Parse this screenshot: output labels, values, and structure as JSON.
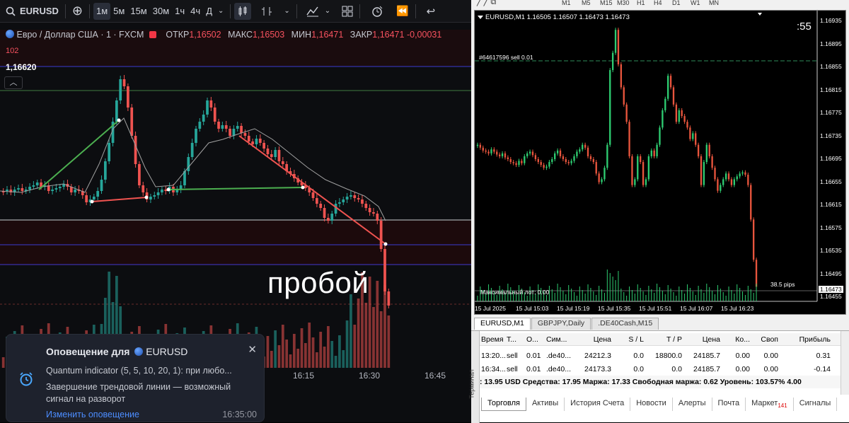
{
  "tv": {
    "symbol": "EURUSD",
    "timeframes": [
      "1м",
      "5м",
      "15м",
      "30м",
      "1ч",
      "4ч",
      "Д"
    ],
    "active_timeframe": "1м",
    "legend": {
      "title": "Евро / Доллар США · 1 · FXCM",
      "open_label": "ОТКР",
      "open": "1,16502",
      "high_label": "МАКС",
      "high": "1,16503",
      "low_label": "МИН",
      "low": "1,16471",
      "close_label": "ЗАКР",
      "close": "1,16471",
      "change": "-0,00031",
      "line2": "102"
    },
    "price_label": "1,16620",
    "annotation": "пробой",
    "time_ticks": [
      "16:15",
      "16:30",
      "16:45"
    ],
    "colors": {
      "bull": "#26a69a",
      "bear": "#ef5350",
      "bg": "#0c0d10"
    },
    "alert": {
      "title": "Оповещение для",
      "symbol": "EURUSD",
      "line1": "Quantum indicator (5, 5, 10, 20, 1): при любо...",
      "line2": "Завершение трендовой линии — возможный сигнал на разворот",
      "link": "Изменить оповещение",
      "time": "16:35:00"
    }
  },
  "mt": {
    "top_periods": [
      "M1",
      "M5",
      "M15",
      "M30",
      "H1",
      "H4",
      "D1",
      "W1",
      "MN"
    ],
    "header": "EURUSD,M1  1.16505 1.16507 1.16473 1.16473",
    "countdown": ":55",
    "order_line": "#64617596 sell 0.01",
    "max_lot": "Максимальный лот: 0.00",
    "pips": "38.5 pips",
    "current_price": "1.16473",
    "y_ticks": [
      "1.16935",
      "1.16895",
      "1.16855",
      "1.16815",
      "1.16775",
      "1.16735",
      "1.16695",
      "1.16655",
      "1.16615",
      "1.16575",
      "1.16535",
      "1.16495",
      "1.16455"
    ],
    "x_ticks": [
      "15 Jul 2025",
      "15 Jul 15:03",
      "15 Jul 15:19",
      "15 Jul 15:35",
      "15 Jul 15:51",
      "15 Jul 16:07",
      "15 Jul 16:23"
    ],
    "window_tabs": [
      "EURUSD,M1",
      "GBPJPY,Daily",
      ".DE40Cash,M15"
    ],
    "terminal_side": "Терминал",
    "columns": [
      "Время",
      "Т...",
      "О...",
      "Сим...",
      "Цена",
      "S / L",
      "T / P",
      "Цена",
      "Ко...",
      "Своп",
      "Прибыль"
    ],
    "rows": [
      [
        "13:20...",
        "sell",
        "0.01",
        ".de40...",
        "24212.3",
        "0.0",
        "18800.0",
        "24185.7",
        "0.00",
        "0.00",
        "0.31"
      ],
      [
        "16:34...",
        "sell",
        "0.01",
        ".de40...",
        "24173.3",
        "0.0",
        "0.0",
        "24185.7",
        "0.00",
        "0.00",
        "-0.14"
      ]
    ],
    "balance": ": 13.95 USD  Средства: 17.95  Маржа: 17.33  Свободная маржа: 0.62  Уровень: 103.57%  4.00",
    "bottom_tabs": [
      "Торговля",
      "Активы",
      "История Счета",
      "Новости",
      "Алерты",
      "Почта",
      "Маркет",
      "Сигналы"
    ],
    "market_badge": "141",
    "chart_data": {
      "type": "candlestick",
      "series": [
        {
          "name": "EURUSD,M1",
          "close": [
            1.1672,
            1.16715,
            1.1671,
            1.16708,
            1.16705,
            1.16712,
            1.16708,
            1.16703,
            1.167,
            1.16705,
            1.16698,
            1.16695,
            1.1669,
            1.16688,
            1.16685,
            1.16692,
            1.16688,
            1.167,
            1.16705,
            1.16708,
            1.16702,
            1.16695,
            1.1669,
            1.16685,
            1.1668,
            1.16682,
            1.1669,
            1.16695,
            1.16705,
            1.1671,
            1.167,
            1.16695,
            1.1669,
            1.16688,
            1.16692,
            1.167,
            1.16708,
            1.16712,
            1.1672,
            1.16715,
            1.167,
            1.16695,
            1.1669,
            1.1667,
            1.16655,
            1.1666,
            1.1668,
            1.1672,
            1.1685,
            1.1688,
            1.1692,
            1.1686,
            1.1682,
            1.1679,
            1.1676,
            1.167,
            1.1665,
            1.1666,
            1.167,
            1.1669,
            1.1665,
            1.1666,
            1.167,
            1.1671,
            1.167,
            1.1672,
            1.1675,
            1.1678,
            1.168,
            1.1684,
            1.1682,
            1.1679,
            1.1676,
            1.1678,
            1.1677,
            1.1676,
            1.1675,
            1.1673,
            1.1674,
            1.1672,
            1.167,
            1.1665,
            1.1669,
            1.1672,
            1.167,
            1.1668,
            1.1666,
            1.1664,
            1.1665,
            1.1666,
            1.1667,
            1.1666,
            1.1665,
            1.1666,
            1.16665,
            1.1667,
            1.16672,
            1.16668,
            1.1665,
            1.1659,
            1.1652,
            1.16473
          ]
        }
      ]
    }
  }
}
